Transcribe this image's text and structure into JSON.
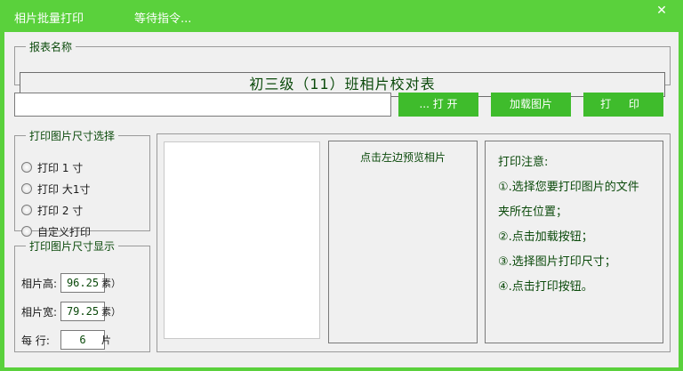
{
  "titlebar": {
    "app_title": "相片批量打印",
    "status": "等待指令...",
    "close_glyph": "✕"
  },
  "report": {
    "legend": "报表名称",
    "title": "初三级（11）班相片校对表"
  },
  "path_input": {
    "value": ""
  },
  "buttons": {
    "open": "... 打 开",
    "load": "加载图片",
    "print": "打 印"
  },
  "size_select": {
    "legend": "打印图片尺寸选择",
    "options": [
      "打印 1 寸",
      "打印 大1寸",
      "打印 2 寸",
      "自定义打印"
    ]
  },
  "size_display": {
    "legend": "打印图片尺寸显示",
    "height_label": "相片高:",
    "height_value": "96.25",
    "height_suffix": "素）",
    "width_label": "相片宽:",
    "width_value": "79.25",
    "width_suffix": "素）",
    "per_row_label": "每  行:",
    "per_row_value": "6",
    "per_row_suffix": "片"
  },
  "preview": {
    "hint": "点击左边预览相片"
  },
  "notes": {
    "title": "打印注意:",
    "lines": [
      "①.选择您要打印图片的文件",
      "夹所在位置；",
      "②.点击加载按钮；",
      "③.选择图片打印尺寸；",
      "④.点击打印按钮。"
    ]
  },
  "colors": {
    "title_bar": "#5ad13c",
    "button": "#3fbc2c",
    "text": "#0b4a0b"
  }
}
